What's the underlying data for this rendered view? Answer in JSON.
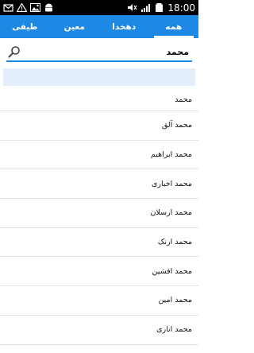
{
  "status_bar": {
    "time": "18:00",
    "left_icons": [
      "mail-icon",
      "warning-icon",
      "image-icon",
      "android-icon"
    ],
    "right_icons": [
      "mute-icon",
      "signal-icon",
      "battery-icon"
    ]
  },
  "tabs": [
    {
      "label": "طیفی",
      "active": false
    },
    {
      "label": "معین",
      "active": false
    },
    {
      "label": "دهخدا",
      "active": false
    },
    {
      "label": "همه",
      "active": true
    }
  ],
  "search": {
    "value": "محمد"
  },
  "results": [
    "محمد",
    "محمد آلق",
    "محمد ابراهیم",
    "محمد اخباری",
    "محمد ارسلان",
    "محمد ارنک",
    "محمد افشین",
    "محمد امین",
    "محمد اناری"
  ],
  "colors": {
    "accent": "#1e88e5",
    "status_bar": "#000000",
    "suggest_bar": "#e3f0fc"
  }
}
